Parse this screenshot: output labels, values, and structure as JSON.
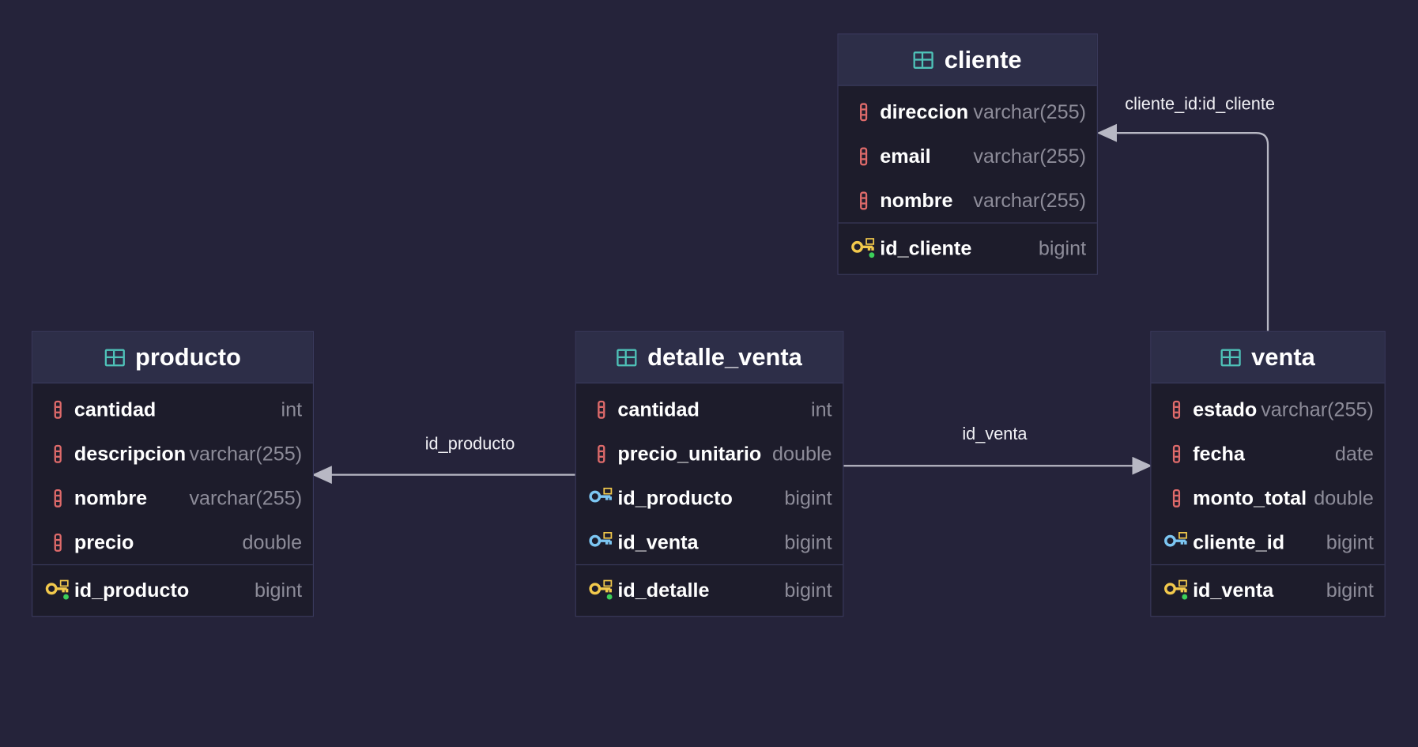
{
  "colors": {
    "background": "#25233a",
    "table_bg": "#1d1c2b",
    "header_bg": "#2d2e48",
    "border": "#3a3a5c",
    "column_icon": "#e06b6b",
    "table_icon": "#4fc3b9",
    "pk_key": "#f2c94c",
    "fk_key": "#7cc6f2",
    "edge": "#b8b8c4"
  },
  "tables": {
    "cliente": {
      "name": "cliente",
      "columns": [
        {
          "name": "direccion",
          "type": "varchar(255)",
          "icon": "column-icon"
        },
        {
          "name": "email",
          "type": "varchar(255)",
          "icon": "column-icon"
        },
        {
          "name": "nombre",
          "type": "varchar(255)",
          "icon": "column-icon"
        }
      ],
      "pk": {
        "name": "id_cliente",
        "type": "bigint",
        "icon": "primary-key-icon"
      }
    },
    "producto": {
      "name": "producto",
      "columns": [
        {
          "name": "cantidad",
          "type": "int",
          "icon": "column-icon"
        },
        {
          "name": "descripcion",
          "type": "varchar(255)",
          "icon": "column-icon"
        },
        {
          "name": "nombre",
          "type": "varchar(255)",
          "icon": "column-icon"
        },
        {
          "name": "precio",
          "type": "double",
          "icon": "column-icon"
        }
      ],
      "pk": {
        "name": "id_producto",
        "type": "bigint",
        "icon": "primary-key-icon"
      }
    },
    "detalle_venta": {
      "name": "detalle_venta",
      "columns": [
        {
          "name": "cantidad",
          "type": "int",
          "icon": "column-icon"
        },
        {
          "name": "precio_unitario",
          "type": "double",
          "icon": "column-icon"
        },
        {
          "name": "id_producto",
          "type": "bigint",
          "icon": "foreign-key-icon"
        },
        {
          "name": "id_venta",
          "type": "bigint",
          "icon": "foreign-key-icon"
        }
      ],
      "pk": {
        "name": "id_detalle",
        "type": "bigint",
        "icon": "primary-key-icon"
      }
    },
    "venta": {
      "name": "venta",
      "columns": [
        {
          "name": "estado",
          "type": "varchar(255)",
          "icon": "column-icon"
        },
        {
          "name": "fecha",
          "type": "date",
          "icon": "column-icon"
        },
        {
          "name": "monto_total",
          "type": "double",
          "icon": "column-icon"
        },
        {
          "name": "cliente_id",
          "type": "bigint",
          "icon": "foreign-key-icon"
        }
      ],
      "pk": {
        "name": "id_venta",
        "type": "bigint",
        "icon": "primary-key-icon"
      }
    }
  },
  "relations": [
    {
      "label": "cliente_id:id_cliente",
      "from": "venta",
      "to": "cliente"
    },
    {
      "label": "id_producto",
      "from": "detalle_venta",
      "to": "producto"
    },
    {
      "label": "id_venta",
      "from": "detalle_venta",
      "to": "venta"
    }
  ]
}
